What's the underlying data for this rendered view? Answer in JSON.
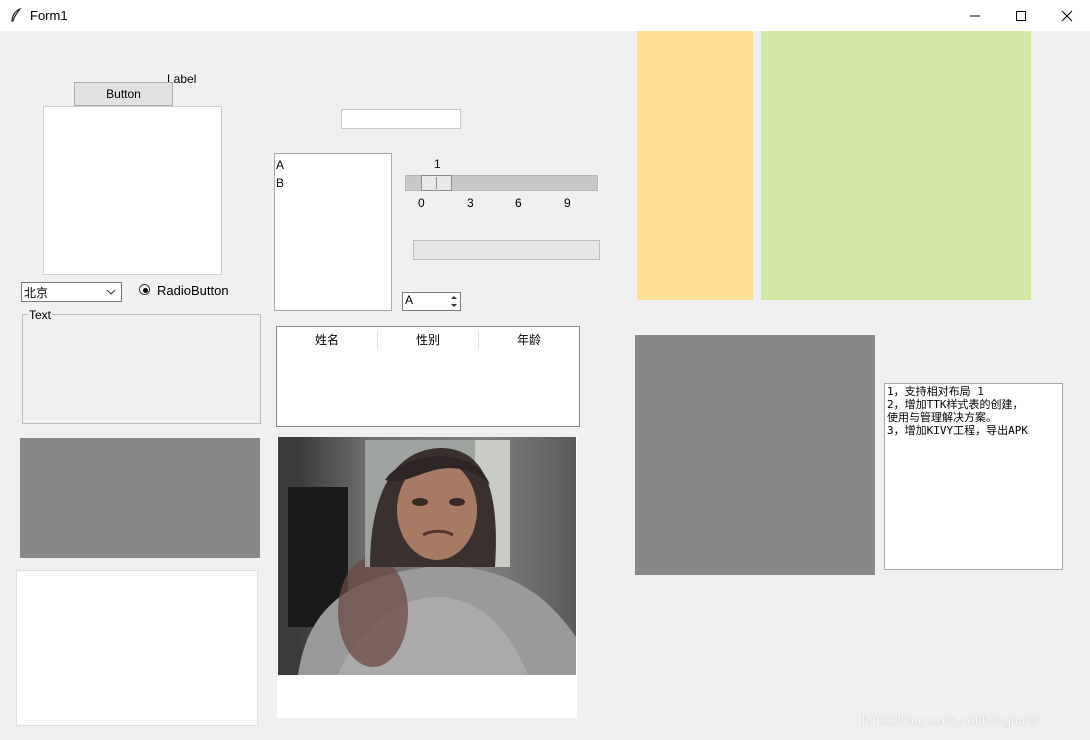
{
  "window": {
    "title": "Form1"
  },
  "widgets": {
    "label": "Label",
    "button": "Button",
    "listbox_items": [
      "A",
      "B"
    ],
    "scale": {
      "value": "1",
      "ticks": [
        "0",
        "3",
        "6",
        "9"
      ]
    },
    "combobox_value": "北京",
    "radiobutton": "RadioButton",
    "spinbox_value": "A",
    "labelframe_title": "Text",
    "tree_columns": [
      "姓名",
      "性别",
      "年龄"
    ],
    "textbox_lines": [
      "1，支持相对布局 1",
      "2，增加TTK样式表的创建，",
      "使用与管理解决方案。",
      "3，增加KIVY工程，导出APK"
    ]
  },
  "colors": {
    "orange_frame": "#ffdd94",
    "green_frame": "#d2e6a5",
    "gray_frame": "#888888"
  },
  "watermark": "https://blog.csdn.net/honghaier"
}
